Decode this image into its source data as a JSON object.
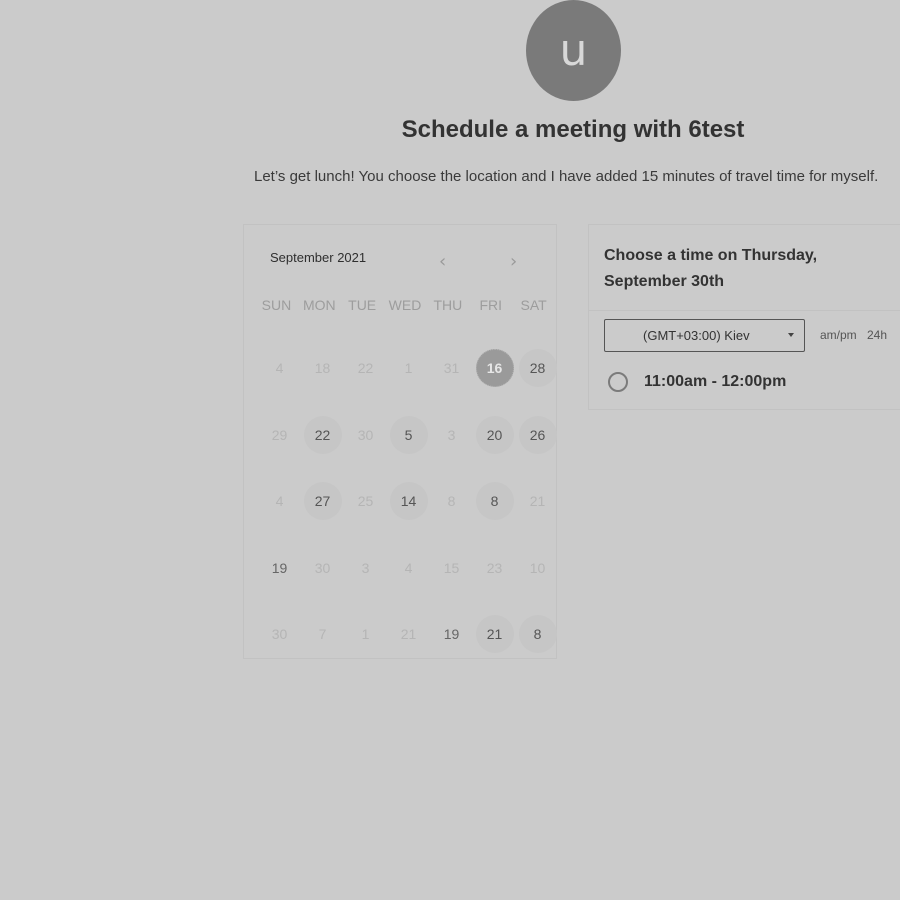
{
  "header": {
    "avatar_letter": "u",
    "title": "Schedule a meeting with 6test",
    "description": "Let’s get lunch! You choose the location and I have added 15 minutes of travel time for myself."
  },
  "calendar": {
    "month_label": "September 2021",
    "prev_icon": "chevron-left-icon",
    "next_icon": "chevron-right-icon",
    "weekdays": [
      "SUN",
      "MON",
      "TUE",
      "WED",
      "THU",
      "FRI",
      "SAT"
    ],
    "weeks": [
      [
        {
          "d": "4"
        },
        {
          "d": "18"
        },
        {
          "d": "22"
        },
        {
          "d": "1"
        },
        {
          "d": "31"
        },
        {
          "d": "16",
          "selected": true
        },
        {
          "d": "28",
          "available": true
        }
      ],
      [
        {
          "d": "29"
        },
        {
          "d": "22",
          "available": true,
          "dark": true
        },
        {
          "d": "30"
        },
        {
          "d": "5",
          "available": true
        },
        {
          "d": "3"
        },
        {
          "d": "20",
          "available": true
        },
        {
          "d": "26",
          "available": true
        }
      ],
      [
        {
          "d": "4"
        },
        {
          "d": "27",
          "available": true
        },
        {
          "d": "25"
        },
        {
          "d": "14",
          "available": true
        },
        {
          "d": "8"
        },
        {
          "d": "8",
          "available": true
        },
        {
          "d": "21"
        }
      ],
      [
        {
          "d": "19",
          "dark": true
        },
        {
          "d": "30"
        },
        {
          "d": "3"
        },
        {
          "d": "4"
        },
        {
          "d": "15"
        },
        {
          "d": "23"
        },
        {
          "d": "10"
        }
      ],
      [
        {
          "d": "30"
        },
        {
          "d": "7"
        },
        {
          "d": "1"
        },
        {
          "d": "21"
        },
        {
          "d": "19",
          "dark": true
        },
        {
          "d": "21",
          "available": true
        },
        {
          "d": "8",
          "available": true,
          "dark": true
        }
      ]
    ]
  },
  "times": {
    "heading": "Choose a time on Thursday, September 30th",
    "timezone": "(GMT+03:00) Kiev",
    "format_ampm": "am/pm",
    "format_24h": "24h",
    "slots": [
      "11:00am - 12:00pm"
    ]
  }
}
